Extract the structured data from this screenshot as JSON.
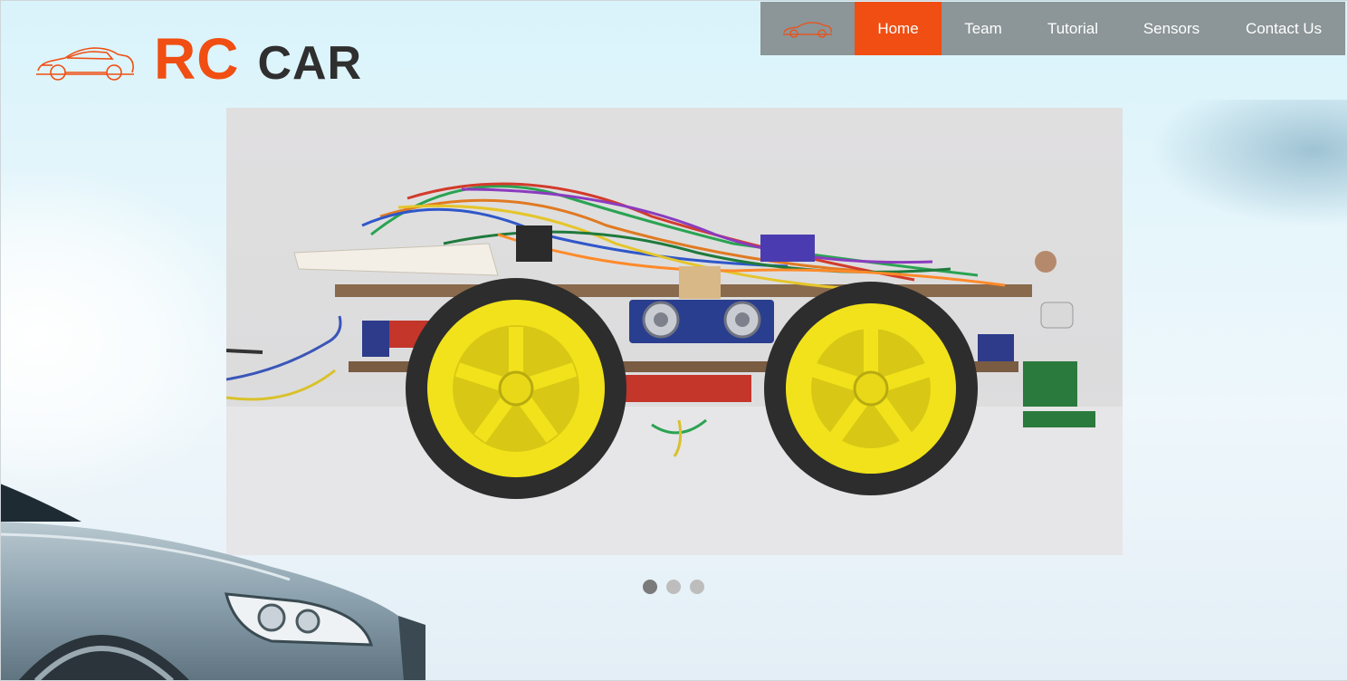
{
  "brand": {
    "rc": "RC",
    "car": "CAR",
    "logo_icon": "car-outline-icon",
    "accent_color": "#f04e12"
  },
  "nav": {
    "logo_icon": "car-outline-icon",
    "items": [
      {
        "label": "Home",
        "active": true
      },
      {
        "label": "Team",
        "active": false
      },
      {
        "label": "Tutorial",
        "active": false
      },
      {
        "label": "Sensors",
        "active": false
      },
      {
        "label": "Contact Us",
        "active": false
      }
    ],
    "background": "#8c9597",
    "active_color": "#f04e12"
  },
  "slider": {
    "image": "rc-car-robot-photo",
    "total_slides": 3,
    "active_index": 0
  },
  "background_image": "silver-car-front"
}
